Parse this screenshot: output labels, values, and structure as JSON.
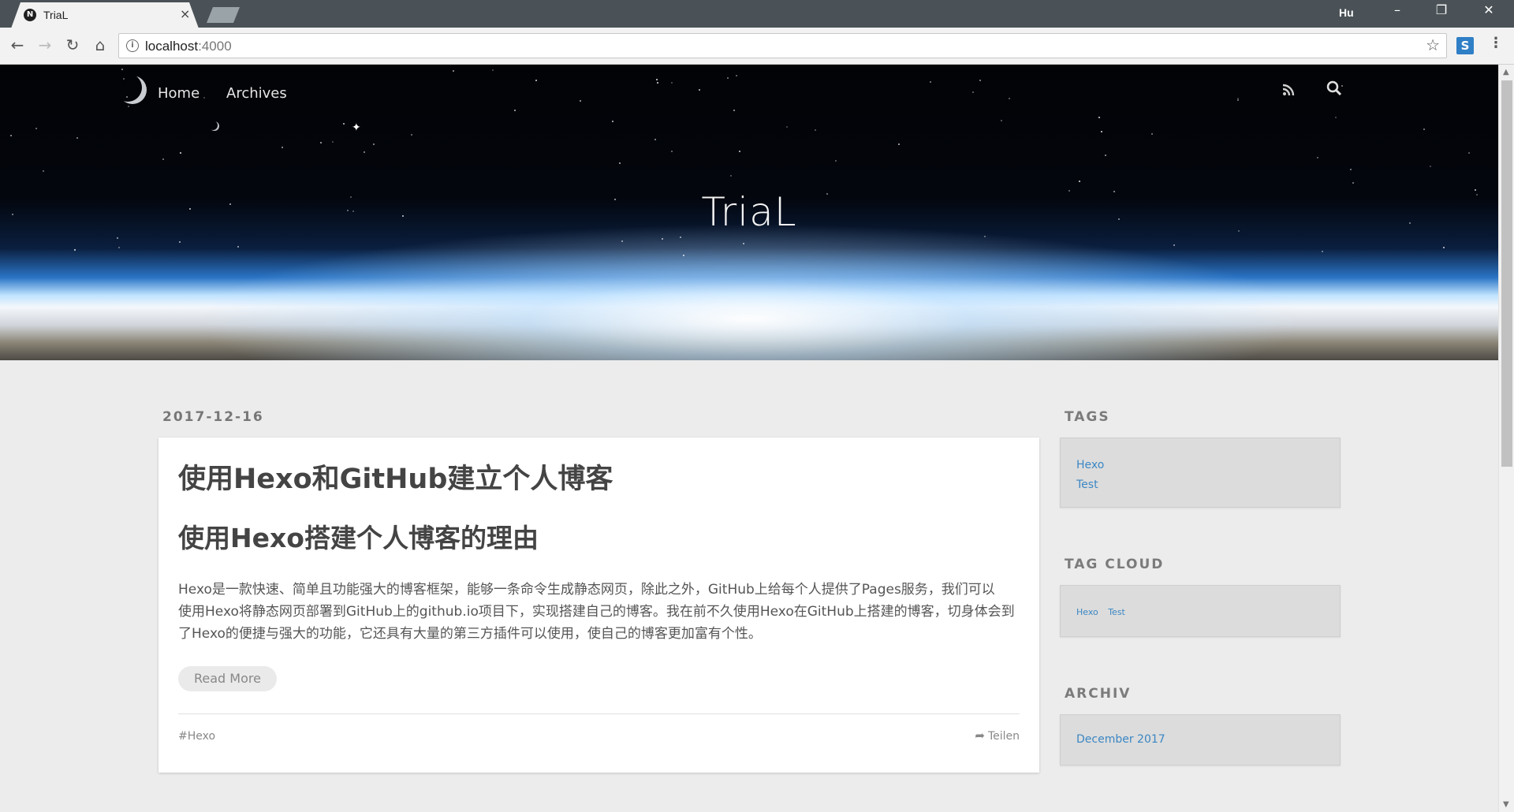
{
  "browser": {
    "tab_title": "TriaL",
    "tab_favicon": "N",
    "close_tab": "×",
    "profile": "Hu",
    "url_host": "localhost",
    "url_port": ":4000",
    "ext_letter": "S"
  },
  "site": {
    "nav": [
      {
        "label": "Home"
      },
      {
        "label": "Archives"
      }
    ],
    "title": "TriaL"
  },
  "post": {
    "date": "2017-12-16",
    "title": "使用Hexo和GitHub建立个人博客",
    "heading": "使用Hexo搭建个人博客的理由",
    "excerpt_lines": [
      "Hexo是一款快速、简单且功能强大的博客框架，能够一条命令生成静态网页，除此之外，GitHub上给每个人提供了Pages服务，我们可以",
      "使用Hexo将静态网页部署到GitHub上的github.io项目下，实现搭建自己的博客。我在前不久使用Hexo在GitHub上搭建的博客，切身体会到",
      "了Hexo的便捷与强大的功能，它还具有大量的第三方插件可以使用，使自己的博客更加富有个性。"
    ],
    "read_more": "Read More",
    "tag": "#Hexo",
    "share": "Teilen"
  },
  "sidebar": {
    "tags_title": "TAGS",
    "tags": [
      "Hexo",
      "Test"
    ],
    "tagcloud_title": "TAG CLOUD",
    "tagcloud": [
      "Hexo",
      "Test"
    ],
    "archive_title": "ARCHIV",
    "archive": [
      "December 2017"
    ]
  },
  "colors": {
    "link": "#3b87c4",
    "background": "#ececec",
    "chrome": "#4a5257"
  }
}
